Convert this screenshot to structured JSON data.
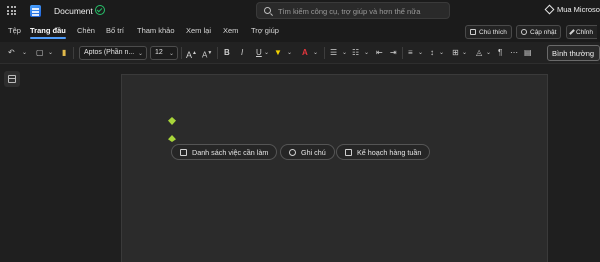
{
  "titlebar": {
    "doc_title": "Document",
    "search_placeholder": "Tìm kiếm công cụ, trợ giúp và hơn thế nữa",
    "premium_label": "Mua Microso"
  },
  "menu": {
    "tabs": [
      "Tệp",
      "Trang đầu",
      "Chèn",
      "Bố trí",
      "Tham khảo",
      "Xem lại",
      "Xem",
      "Trợ giúp"
    ],
    "active_tab": "Trang đầu",
    "comments_label": "Chú thích",
    "catchup_label": "Cập nhật",
    "editing_label": "Chỉnh"
  },
  "ribbon": {
    "font_name": "Aptos (Phần n...",
    "font_size": "12",
    "style_name": "Bình thường"
  },
  "suggestions": [
    "Danh sách việc cần làm",
    "Ghi chú",
    "Kế hoạch hàng tuần"
  ],
  "colors": {
    "accent": "#4f9cf9",
    "copilot": "#a8d53a",
    "highlight": "#f2d100",
    "font_color": "#e8363d"
  }
}
